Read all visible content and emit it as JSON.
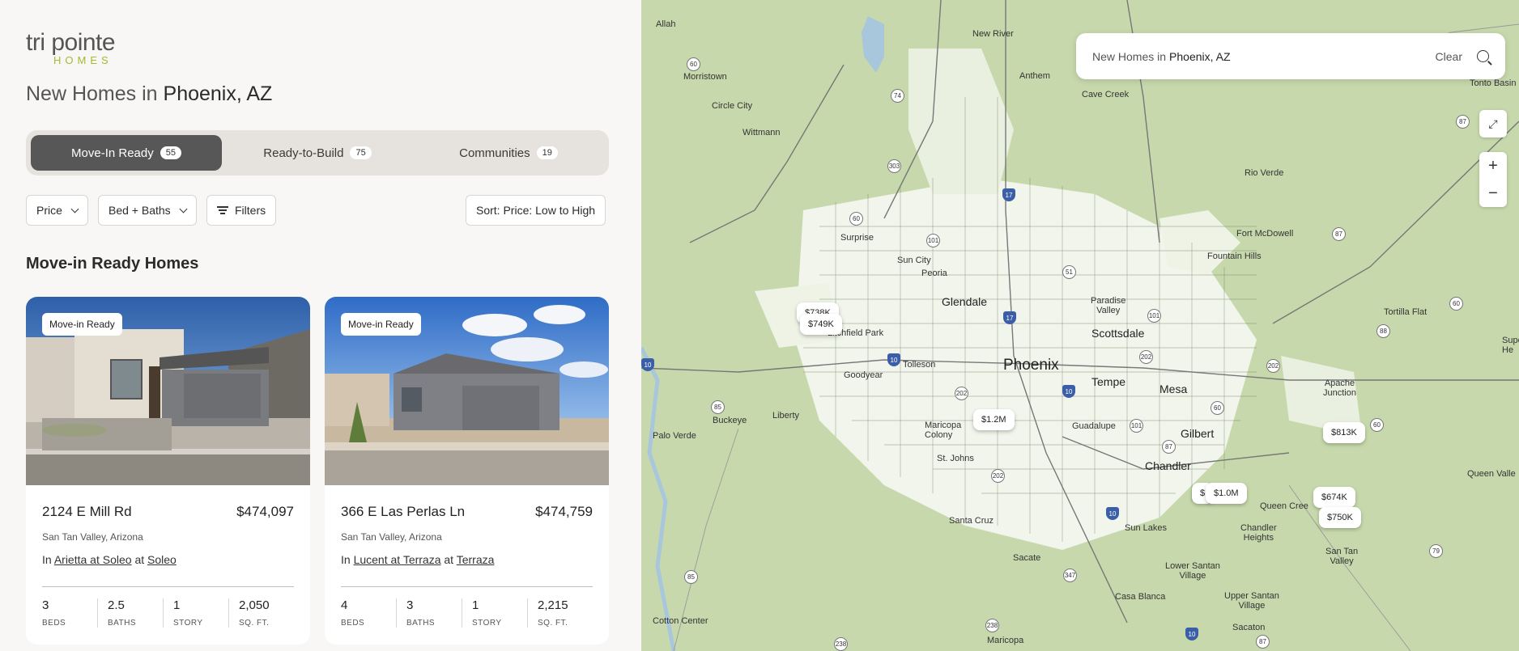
{
  "brand": {
    "word": "tri pointe",
    "sub": "HOMES",
    "accent": "#a8b82f"
  },
  "heading": {
    "prefix": "New Homes in",
    "city": "Phoenix, AZ"
  },
  "tabs": [
    {
      "label": "Move-In Ready",
      "count": "55",
      "active": true
    },
    {
      "label": "Ready-to-Build",
      "count": "75",
      "active": false
    },
    {
      "label": "Communities",
      "count": "19",
      "active": false
    }
  ],
  "filters": {
    "price": "Price",
    "bed_baths": "Bed + Baths",
    "filters": "Filters",
    "sort": "Sort: Price: Low to High"
  },
  "section_title": "Move-in Ready Homes",
  "cards": [
    {
      "tag": "Move-in Ready",
      "address": "2124 E Mill Rd",
      "price": "$474,097",
      "location": "San Tan Valley, Arizona",
      "in_text": "In",
      "community": "Arietta at Soleo",
      "at_text": "at",
      "master": "Soleo",
      "stats": [
        {
          "value": "3",
          "label": "BEDS"
        },
        {
          "value": "2.5",
          "label": "BATHS"
        },
        {
          "value": "1",
          "label": "STORY"
        },
        {
          "value": "2,050",
          "label": "SQ. FT."
        }
      ]
    },
    {
      "tag": "Move-in Ready",
      "address": "366 E Las Perlas Ln",
      "price": "$474,759",
      "location": "San Tan Valley, Arizona",
      "in_text": "In",
      "community": "Lucent at Terraza",
      "at_text": "at",
      "master": "Terraza",
      "stats": [
        {
          "value": "4",
          "label": "BEDS"
        },
        {
          "value": "3",
          "label": "BATHS"
        },
        {
          "value": "1",
          "label": "STORY"
        },
        {
          "value": "2,215",
          "label": "SQ. FT."
        }
      ]
    }
  ],
  "map": {
    "search_prefix": "New Homes in",
    "search_city": "Phoenix, AZ",
    "clear": "Clear",
    "zoom_in": "+",
    "zoom_out": "−",
    "pins": [
      "$738K",
      "$749K",
      "$1.2M",
      "$1.0M",
      "$",
      "$813K",
      "$674K",
      "$750K"
    ],
    "places": {
      "allah": "Allah",
      "new_river": "New River",
      "morristown": "Morristown",
      "anthem": "Anthem",
      "cave_creek": "Cave Creek",
      "circle_city": "Circle City",
      "wittmann": "Wittmann",
      "surprise": "Surprise",
      "sun_city": "Sun City",
      "peoria": "Peoria",
      "glendale": "Glendale",
      "paradise_valley": "Paradise\nValley",
      "scottsdale": "Scottsdale",
      "litchfield_park": "Litchfield Park",
      "tolleson": "Tolleson",
      "phoenix": "Phoenix",
      "tempe": "Tempe",
      "mesa": "Mesa",
      "goodyear": "Goodyear",
      "buckeye": "Buckeye",
      "liberty": "Liberty",
      "maricopa_colony": "Maricopa\nColony",
      "guadalupe": "Guadalupe",
      "gilbert": "Gilbert",
      "chandler": "Chandler",
      "st_johns": "St. Johns",
      "palo_verde": "Palo Verde",
      "santa_cruz": "Santa Cruz",
      "sun_lakes": "Sun Lakes",
      "queen_creek": "Queen Cree",
      "chandler_heights": "Chandler\nHeights",
      "san_tan_valley": "San Tan\nValley",
      "sacate": "Sacate",
      "lower_santan": "Lower Santan\nVillage",
      "casa_blanca": "Casa Blanca",
      "upper_santan": "Upper Santan\nVillage",
      "sacaton": "Sacaton",
      "cotton_center": "Cotton Center",
      "maricopa": "Maricopa",
      "rio_verde": "Rio Verde",
      "fort_mcdowell": "Fort McDowell",
      "fountain_hills": "Fountain Hills",
      "tortilla_flat": "Tortilla Flat",
      "apache_junction": "Apache\nJunction",
      "queen_valley": "Queen Valle",
      "tonto_basin": "Tonto Basin",
      "superior": "Supe\nHe"
    }
  }
}
